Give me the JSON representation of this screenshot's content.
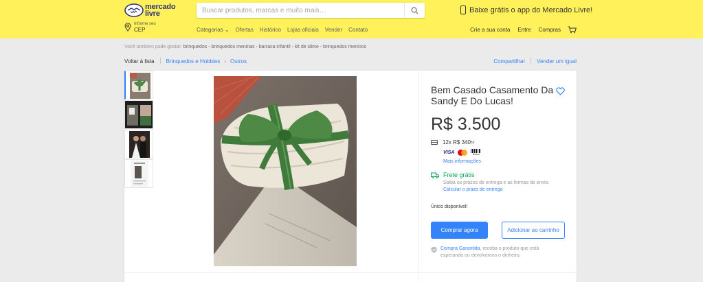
{
  "header": {
    "logo_line1": "mercado",
    "logo_line2": "livre",
    "search_placeholder": "Buscar produtos, marcas e muito mais…",
    "promo_text": "Baixe grátis o app do Mercado Livre!",
    "cep_small": "Informe seu",
    "cep_big": "CEP",
    "nav": [
      "Categorias ⌄",
      "Ofertas",
      "Histórico",
      "Lojas oficiais",
      "Vender",
      "Contato"
    ],
    "account": {
      "create": "Crie a sua conta",
      "login": "Entre",
      "purchases": "Compras"
    }
  },
  "suggestions": {
    "label": "Você também pode gostar:",
    "links": "brinquedos - brinquedos meninas - barraca infantil - kit de slime - brinquedos meninos"
  },
  "breadcrumb": {
    "back": "Voltar à lista",
    "category": "Brinquedos e Hobbies",
    "subcategory": "Outros",
    "share": "Compartilhar",
    "sell_same": "Vender um igual"
  },
  "product": {
    "title": "Bem Casado Casamento Da Sandy E Do Lucas!",
    "price": "R$ 3.500",
    "installments_main": "12x R$ 340",
    "installments_cents": "52",
    "payment_more": "Mais informações",
    "boleto_label": "Boleto",
    "shipping_title": "Frete grátis",
    "shipping_sub": "Saiba os prazos de entrega e as formas de envio.",
    "shipping_calc": "Calcular o prazo de entrega",
    "stock": "Único disponível!",
    "buy_now": "Comprar agora",
    "add_to_cart": "Adicionar ao carrinho",
    "guarantee_link": "Compra Garantida",
    "guarantee_text": ", receba o produto que está esperando ou devolvemos o dinheiro."
  },
  "colors": {
    "header_bg": "#fff159",
    "accent": "#3483fa",
    "free_shipping": "#00a650"
  },
  "icons": [
    "handshake-logo-icon",
    "search-icon",
    "phone-icon",
    "location-pin-icon",
    "cart-icon",
    "heart-icon",
    "credit-card-icon",
    "truck-icon",
    "shield-icon"
  ]
}
